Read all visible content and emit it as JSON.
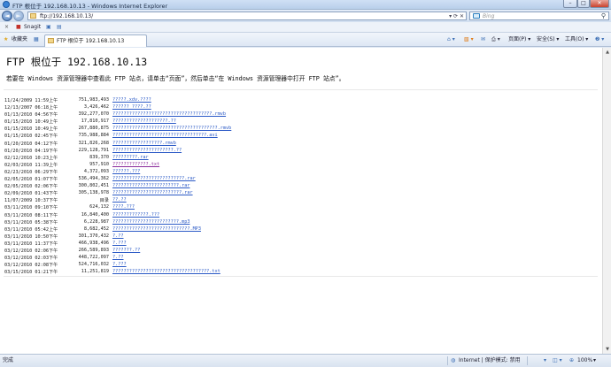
{
  "window": {
    "title": "FTP 根位于 192.168.10.13 - Windows Internet Explorer"
  },
  "nav": {
    "address": "ftp://192.168.10.13/",
    "search_placeholder": "Bing",
    "back_glyph": "◄",
    "forward_glyph": "►"
  },
  "toolbar1": {
    "close_glyph": "×",
    "snagit_label": "Snagit"
  },
  "favbar": {
    "favorites_label": "收藏夹",
    "tab_title": "FTP 根位于 192.168.10.13",
    "commands": [
      "页面(P) ▾",
      "安全(S) ▾",
      "工具(O) ▾",
      "❷ ▾"
    ]
  },
  "page": {
    "heading": "FTP 根位于 192.168.10.13",
    "hint": "若要在 Windows 资源管理器中查看此 FTP 站点，请单击“页面”，然后单击“在 Windows 资源管理器中打开 FTP 站点”。",
    "rows": [
      {
        "date": "11/24/2009 11:59上午",
        "size": "751,983,493",
        "name": "?????.xdv.????"
      },
      {
        "date": "12/13/2007 06:18上午",
        "size": "3,426,462",
        "name": "??????_????.??"
      },
      {
        "date": "01/13/2010 04:56下午",
        "size": "392,277,070",
        "name": "????????????????????????????????????.rmvb"
      },
      {
        "date": "01/15/2010 10:49上午",
        "size": "17,810,917",
        "name": "????????????????????.??"
      },
      {
        "date": "01/15/2010 10:49上午",
        "size": "267,880,875",
        "name": "??????????????????????????????????????.rmvb"
      },
      {
        "date": "01/15/2010 02:45下午",
        "size": "735,988,884",
        "name": "??????????????????????????????????.avi"
      },
      {
        "date": "01/20/2010 04:12下午",
        "size": "321,826,268",
        "name": "??????????????????.rmvb"
      },
      {
        "date": "01/20/2010 04:19下午",
        "size": "229,128,791",
        "name": "??????????????????????.??"
      },
      {
        "date": "02/12/2010 10:23上午",
        "size": "839,370",
        "name": "?????????.rar"
      },
      {
        "date": "02/03/2010 11:39上午",
        "size": "957,910",
        "name": "?????????????.txt",
        "visited": true
      },
      {
        "date": "02/23/2010 06:29下午",
        "size": "4,372,093",
        "name": "??????.???"
      },
      {
        "date": "02/05/2010 01:07下午",
        "size": "536,494,362",
        "name": "??????????????????????????.rar"
      },
      {
        "date": "02/05/2010 02:06下午",
        "size": "300,802,451",
        "name": "????????????????????????.rar"
      },
      {
        "date": "02/09/2010 01:43下午",
        "size": "305,138,978",
        "name": "?????????????????????????.rar"
      },
      {
        "date": "11/07/2009 10:37下午",
        "size": "目录",
        "name": "??.??"
      },
      {
        "date": "03/11/2010 09:10下午",
        "size": "624,132",
        "name": "????.???"
      },
      {
        "date": "03/11/2010 08:11下午",
        "size": "16,840,400",
        "name": "?????????????.???"
      },
      {
        "date": "03/11/2010 05:38下午",
        "size": "6,228,987",
        "name": "????????????????????????.mp3"
      },
      {
        "date": "03/11/2010 05:42上午",
        "size": "8,682,452",
        "name": "????????????????????????????.MP3"
      },
      {
        "date": "03/11/2010 10:50下午",
        "size": "301,370,432",
        "name": "?.??"
      },
      {
        "date": "03/11/2010 11:37下午",
        "size": "466,938,496",
        "name": "?.???"
      },
      {
        "date": "03/12/2010 02:06下午",
        "size": "266,589,893",
        "name": "???????.??"
      },
      {
        "date": "03/12/2010 02:03下午",
        "size": "448,722,097",
        "name": "?.??"
      },
      {
        "date": "03/12/2010 02:08下午",
        "size": "524,716,032",
        "name": "?.???"
      },
      {
        "date": "03/15/2010 01:21下午",
        "size": "11,251,819",
        "name": "???????????????????????????????????.txt"
      }
    ]
  },
  "status": {
    "left": "完成",
    "zone": "Internet | 保护模式: 禁用",
    "zoom": "100%"
  },
  "colors": {
    "link": "#2a59c6",
    "visited": "#8a2a9a"
  }
}
